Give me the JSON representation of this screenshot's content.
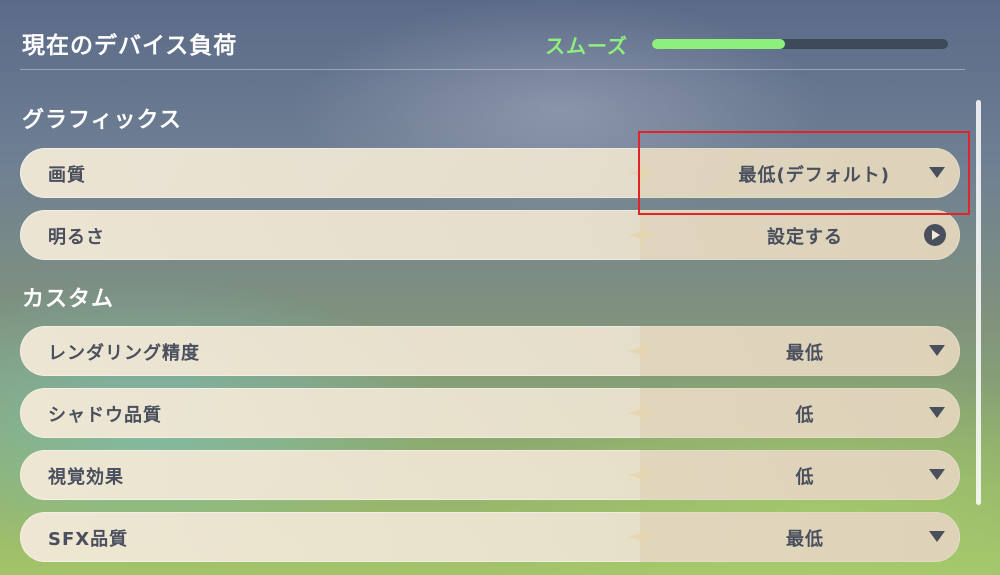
{
  "header": {
    "title": "現在のデバイス負荷",
    "status_label": "スムーズ",
    "load_level": 0.45,
    "status_color": "#8ef07c"
  },
  "sections": [
    {
      "title": "グラフィックス",
      "rows": [
        {
          "label": "画質",
          "value": "最低(デフォルト)",
          "control": "dropdown"
        },
        {
          "label": "明るさ",
          "value": "設定する",
          "control": "arrow-button"
        }
      ]
    },
    {
      "title": "カスタム",
      "rows": [
        {
          "label": "レンダリング精度",
          "value": "最低",
          "control": "dropdown"
        },
        {
          "label": "シャドウ品質",
          "value": "低",
          "control": "dropdown"
        },
        {
          "label": "視覚効果",
          "value": "低",
          "control": "dropdown"
        },
        {
          "label": "SFX品質",
          "value": "最低",
          "control": "dropdown"
        }
      ]
    }
  ],
  "icons": {
    "dropdown": "chevron-down-icon",
    "arrow_button": "arrow-right-circle-icon"
  },
  "highlight_color": "#e0242a"
}
